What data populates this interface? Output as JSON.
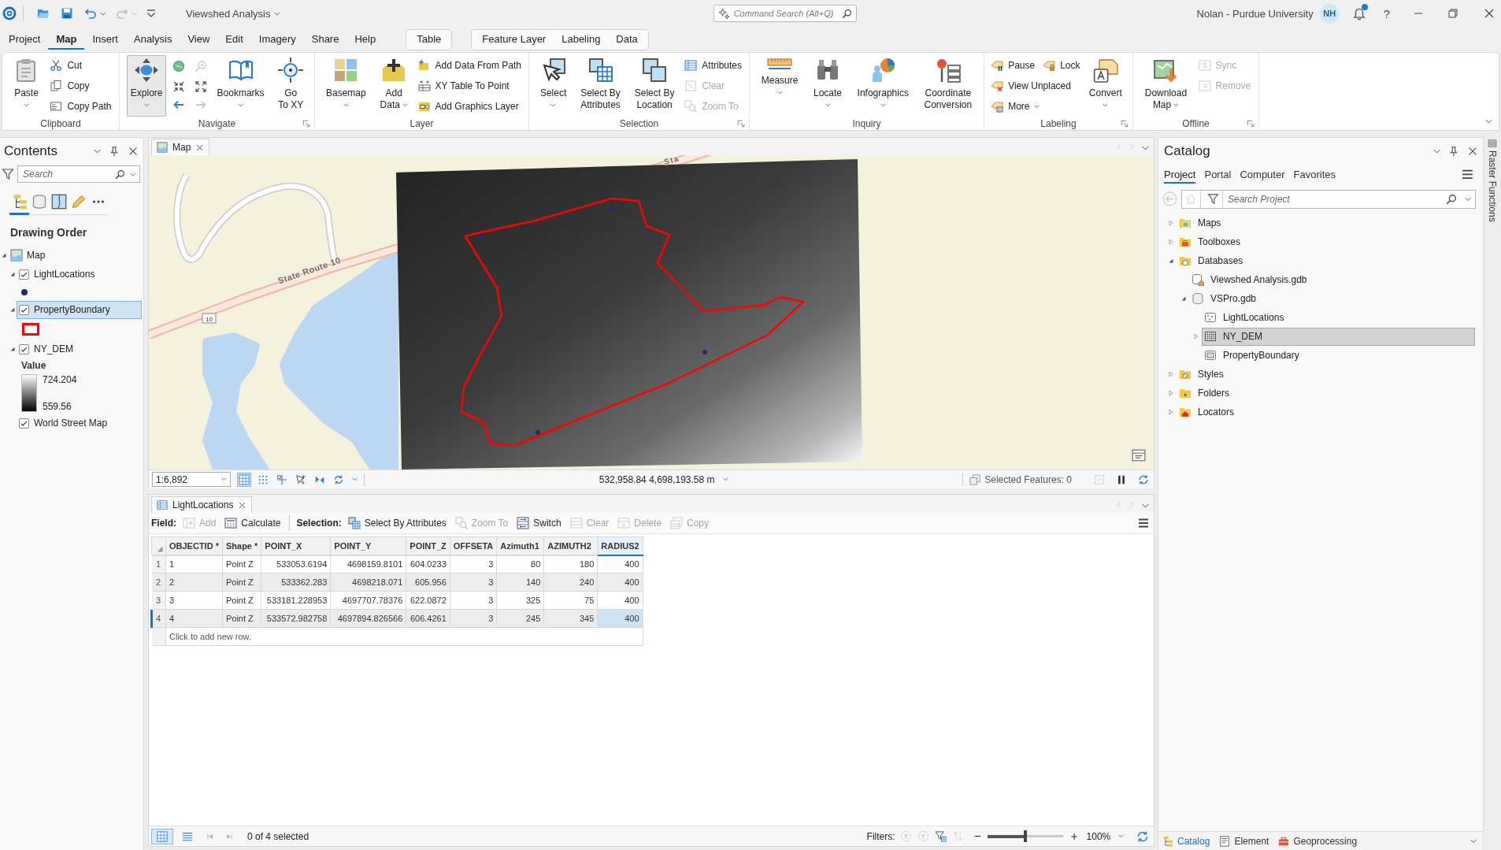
{
  "title_bar": {
    "quick_access": [
      {
        "dropdown": false,
        "disabled": false
      },
      {
        "dropdown": false,
        "disabled": false
      },
      {
        "dropdown": true,
        "disabled": false
      },
      {
        "dropdown": true,
        "disabled": true
      },
      {
        "dropdown": false,
        "disabled": false
      }
    ],
    "title": "Viewshed Analysis",
    "command_search": {
      "placeholder": "Command Search (Alt+Q)"
    },
    "user": "Nolan - Purdue University",
    "avatar": "NH",
    "notification": true,
    "help": "?"
  },
  "menu_tabs": [
    {
      "label": "Project",
      "selected": false
    },
    {
      "label": "Map",
      "selected": true
    },
    {
      "label": "Insert",
      "selected": false
    },
    {
      "label": "Analysis",
      "selected": false
    },
    {
      "label": "View",
      "selected": false
    },
    {
      "label": "Edit",
      "selected": false
    },
    {
      "label": "Imagery",
      "selected": false
    },
    {
      "label": "Share",
      "selected": false
    },
    {
      "label": "Help",
      "selected": false
    }
  ],
  "contextual_tab_groups": [
    {
      "tabs": [
        {
          "label": "Table",
          "selected": false
        }
      ]
    },
    {
      "tabs": [
        {
          "label": "Feature Layer",
          "selected": false
        },
        {
          "label": "Labeling",
          "selected": false
        },
        {
          "label": "Data",
          "selected": false
        }
      ]
    }
  ],
  "ribbon_groups": [
    {
      "label": "Clipboard",
      "launcher": false,
      "items": [
        {
          "kind": "large",
          "lines": [
            "Paste"
          ],
          "dropdown": true,
          "active": false
        },
        {
          "kind": "stack",
          "rows": [
            [
              {
                "label": "Cut",
                "dropdown": false,
                "disabled": false
              }
            ],
            [
              {
                "label": "Copy",
                "dropdown": false,
                "disabled": false
              }
            ],
            [
              {
                "label": "Copy Path",
                "dropdown": false,
                "disabled": false
              }
            ]
          ]
        }
      ]
    },
    {
      "label": "Navigate",
      "launcher": true,
      "items": [
        {
          "kind": "large",
          "lines": [
            "Explore"
          ],
          "dropdown": true,
          "active": true
        },
        {
          "kind": "tools",
          "tools": [
            {
              "disabled": false
            },
            {
              "disabled": true
            },
            {
              "disabled": false
            },
            {
              "disabled": false
            },
            {
              "disabled": false
            },
            {
              "disabled": true
            }
          ]
        },
        {
          "kind": "large",
          "lines": [
            "Bookmarks"
          ],
          "dropdown": true,
          "active": false
        },
        {
          "kind": "large",
          "lines": [
            "Go",
            "To XY"
          ],
          "dropdown": false,
          "active": false
        }
      ]
    },
    {
      "label": "Layer",
      "launcher": false,
      "items": [
        {
          "kind": "large",
          "lines": [
            "Basemap"
          ],
          "dropdown": true,
          "active": false
        },
        {
          "kind": "large",
          "lines": [
            "Add",
            "Data"
          ],
          "dropdown": true,
          "active": false
        },
        {
          "kind": "stack",
          "rows": [
            [
              {
                "label": "Add Data From Path",
                "dropdown": false,
                "disabled": false
              }
            ],
            [
              {
                "label": "XY Table To Point",
                "dropdown": false,
                "disabled": false
              }
            ],
            [
              {
                "label": "Add Graphics Layer",
                "dropdown": false,
                "disabled": false
              }
            ]
          ]
        }
      ]
    },
    {
      "label": "Selection",
      "launcher": true,
      "items": [
        {
          "kind": "large",
          "lines": [
            "Select"
          ],
          "dropdown": true,
          "active": false
        },
        {
          "kind": "large",
          "lines": [
            "Select By",
            "Attributes"
          ],
          "dropdown": false,
          "active": false
        },
        {
          "kind": "large",
          "lines": [
            "Select By",
            "Location"
          ],
          "dropdown": false,
          "active": false
        },
        {
          "kind": "stack",
          "rows": [
            [
              {
                "label": "Attributes",
                "dropdown": false,
                "disabled": false
              }
            ],
            [
              {
                "label": "Clear",
                "dropdown": false,
                "disabled": true
              }
            ],
            [
              {
                "label": "Zoom To",
                "dropdown": false,
                "disabled": true
              }
            ]
          ]
        }
      ]
    },
    {
      "label": "Inquiry",
      "launcher": false,
      "items": [
        {
          "kind": "large",
          "lines": [
            "Measure"
          ],
          "dropdown": true,
          "active": false
        },
        {
          "kind": "large",
          "lines": [
            "Locate"
          ],
          "dropdown": true,
          "active": false
        },
        {
          "kind": "large",
          "lines": [
            "Infographics"
          ],
          "dropdown": true,
          "active": false
        },
        {
          "kind": "large",
          "lines": [
            "Coordinate",
            "Conversion"
          ],
          "dropdown": false,
          "active": false
        }
      ]
    },
    {
      "label": "Labeling",
      "launcher": true,
      "items": [
        {
          "kind": "stack",
          "rows": [
            [
              {
                "label": "Pause",
                "dropdown": false,
                "disabled": false
              },
              {
                "label": "Lock",
                "dropdown": false,
                "disabled": false
              }
            ],
            [
              {
                "label": "View Unplaced",
                "dropdown": false,
                "disabled": false
              }
            ],
            [
              {
                "label": "More",
                "dropdown": true,
                "disabled": false
              }
            ]
          ]
        },
        {
          "kind": "large",
          "lines": [
            "Convert"
          ],
          "dropdown": true,
          "active": false
        }
      ]
    },
    {
      "label": "Offline",
      "launcher": true,
      "items": [
        {
          "kind": "large",
          "lines": [
            "Download",
            "Map"
          ],
          "dropdown": true,
          "active": false
        },
        {
          "kind": "stack",
          "rows": [
            [
              {
                "label": "Sync",
                "dropdown": false,
                "disabled": true
              }
            ],
            [
              {
                "label": "Remove",
                "dropdown": false,
                "disabled": true
              }
            ]
          ]
        }
      ]
    }
  ],
  "contents": {
    "title": "Contents",
    "search": {
      "placeholder": "Search"
    },
    "view_tabs": [
      {
        "selected": true
      },
      {
        "selected": false
      },
      {
        "selected": false
      },
      {
        "selected": false
      }
    ],
    "heading": "Drawing Order",
    "layers": [
      {
        "name": "Map",
        "expanded": true,
        "children": [
          {
            "name": "LightLocations",
            "checked": true,
            "expanded": true,
            "selected": false,
            "symbol": {
              "kind": "point",
              "color": "#1f2a78"
            }
          },
          {
            "name": "PropertyBoundary",
            "checked": true,
            "expanded": true,
            "selected": true,
            "symbol": {
              "kind": "polygon",
              "color": "#ff0000"
            }
          },
          {
            "name": "NY_DEM",
            "checked": true,
            "expanded": true,
            "selected": false,
            "symbol": {
              "kind": "stretch",
              "title": "Value",
              "high": "724.204",
              "low": "559.56"
            }
          },
          {
            "name": "World Street Map",
            "checked": true,
            "selected": false
          }
        ]
      }
    ]
  },
  "map_view": {
    "tab": {
      "label": "Map"
    },
    "nav": [
      {
        "disabled": true
      },
      {
        "disabled": true
      }
    ],
    "road_labels": [
      "State Route 10",
      "Sta"
    ],
    "route_shield": "10",
    "status": {
      "scale": "1:6,892",
      "tools": [
        {
          "selected": true
        },
        {
          "selected": false
        },
        {
          "selected": false
        },
        {
          "selected": false
        },
        {
          "selected": false
        },
        {
          "selected": false
        }
      ],
      "coordinates": "532,958.84 4,698,193.58 m",
      "selected_features": "Selected Features: 0",
      "controls": [
        {
          "disabled": true
        },
        {
          "disabled": false
        },
        {
          "disabled": false
        }
      ]
    }
  },
  "table_view": {
    "tab": {
      "label": "LightLocations"
    },
    "nav": [
      {
        "disabled": true
      },
      {
        "disabled": true
      }
    ],
    "field_label": "Field:",
    "field_tools": [
      {
        "label": "Add",
        "disabled": true
      },
      {
        "label": "Calculate",
        "disabled": false
      }
    ],
    "selection_label": "Selection:",
    "selection_tools": [
      {
        "label": "Select By Attributes",
        "disabled": false
      },
      {
        "label": "Zoom To",
        "disabled": true
      },
      {
        "label": "Switch",
        "disabled": false
      },
      {
        "label": "Clear",
        "disabled": true
      },
      {
        "label": "Delete",
        "disabled": true
      },
      {
        "label": "Copy",
        "disabled": true
      }
    ],
    "columns": [
      {
        "label": "OBJECTID *",
        "selected": false
      },
      {
        "label": "Shape *",
        "selected": false
      },
      {
        "label": "POINT_X",
        "selected": false
      },
      {
        "label": "POINT_Y",
        "selected": false
      },
      {
        "label": "POINT_Z",
        "selected": false
      },
      {
        "label": "OFFSETA",
        "selected": false
      },
      {
        "label": "Azimuth1",
        "selected": false
      },
      {
        "label": "AZIMUTH2",
        "selected": false
      },
      {
        "label": "RADIUS2",
        "selected": true
      }
    ],
    "rows": [
      {
        "number": "1",
        "current": false,
        "cells": [
          "1",
          "Point Z",
          "533053.6194",
          "4698159.8101",
          "604.0233",
          "3",
          "80",
          "180",
          "400"
        ]
      },
      {
        "number": "2",
        "current": false,
        "cells": [
          "2",
          "Point Z",
          "533362.283",
          "4698218.071",
          "605.956",
          "3",
          "140",
          "240",
          "400"
        ]
      },
      {
        "number": "3",
        "current": false,
        "cells": [
          "3",
          "Point Z",
          "533181.228953",
          "4697707.78376",
          "622.0872",
          "3",
          "325",
          "75",
          "400"
        ]
      },
      {
        "number": "4",
        "current": true,
        "cells": [
          "4",
          "Point Z",
          "533572.982758",
          "4697894.826566",
          "606.4261",
          "3",
          "245",
          "345",
          "400"
        ]
      }
    ],
    "new_row": "Click to add new row.",
    "view_buttons": [
      {
        "selected": true
      },
      {
        "selected": false
      }
    ],
    "paging": [
      {
        "disabled": true
      },
      {
        "disabled": true
      }
    ],
    "selection_count": "0 of 4 selected",
    "filters_label": "Filters:",
    "filters": [
      {
        "disabled": true
      },
      {
        "disabled": true
      },
      {
        "disabled": false
      },
      {
        "disabled": true
      }
    ],
    "zoom": {
      "level": 0.5,
      "reading": "100%"
    }
  },
  "catalog": {
    "title": "Catalog",
    "tabs": [
      {
        "label": "Project",
        "selected": true
      },
      {
        "label": "Portal",
        "selected": false
      },
      {
        "label": "Computer",
        "selected": false
      },
      {
        "label": "Favorites",
        "selected": false
      }
    ],
    "nav": [
      {
        "disabled": true
      },
      {
        "disabled": true
      }
    ],
    "search": {
      "placeholder": "Search Project"
    },
    "items": [
      {
        "name": "Maps",
        "expanded": false,
        "selected": false
      },
      {
        "name": "Toolboxes",
        "expanded": false,
        "selected": false
      },
      {
        "name": "Databases",
        "expanded": true,
        "selected": false,
        "children": [
          {
            "name": "Viewshed Analysis.gdb",
            "selected": false
          },
          {
            "name": "VSPro.gdb",
            "expanded": true,
            "selected": false,
            "children": [
              {
                "name": "LightLocations",
                "selected": false
              },
              {
                "name": "NY_DEM",
                "expanded": false,
                "selected": true
              },
              {
                "name": "PropertyBoundary",
                "selected": false
              }
            ]
          }
        ]
      },
      {
        "name": "Styles",
        "expanded": false,
        "selected": false
      },
      {
        "name": "Folders",
        "expanded": false,
        "selected": false
      },
      {
        "name": "Locators",
        "expanded": false,
        "selected": false
      }
    ],
    "bottom_tabs": [
      {
        "label": "Catalog",
        "selected": true
      },
      {
        "label": "Element",
        "selected": false
      },
      {
        "label": "Geoprocessing",
        "selected": false
      }
    ]
  },
  "side_tab": {
    "label": "Raster Functions"
  }
}
